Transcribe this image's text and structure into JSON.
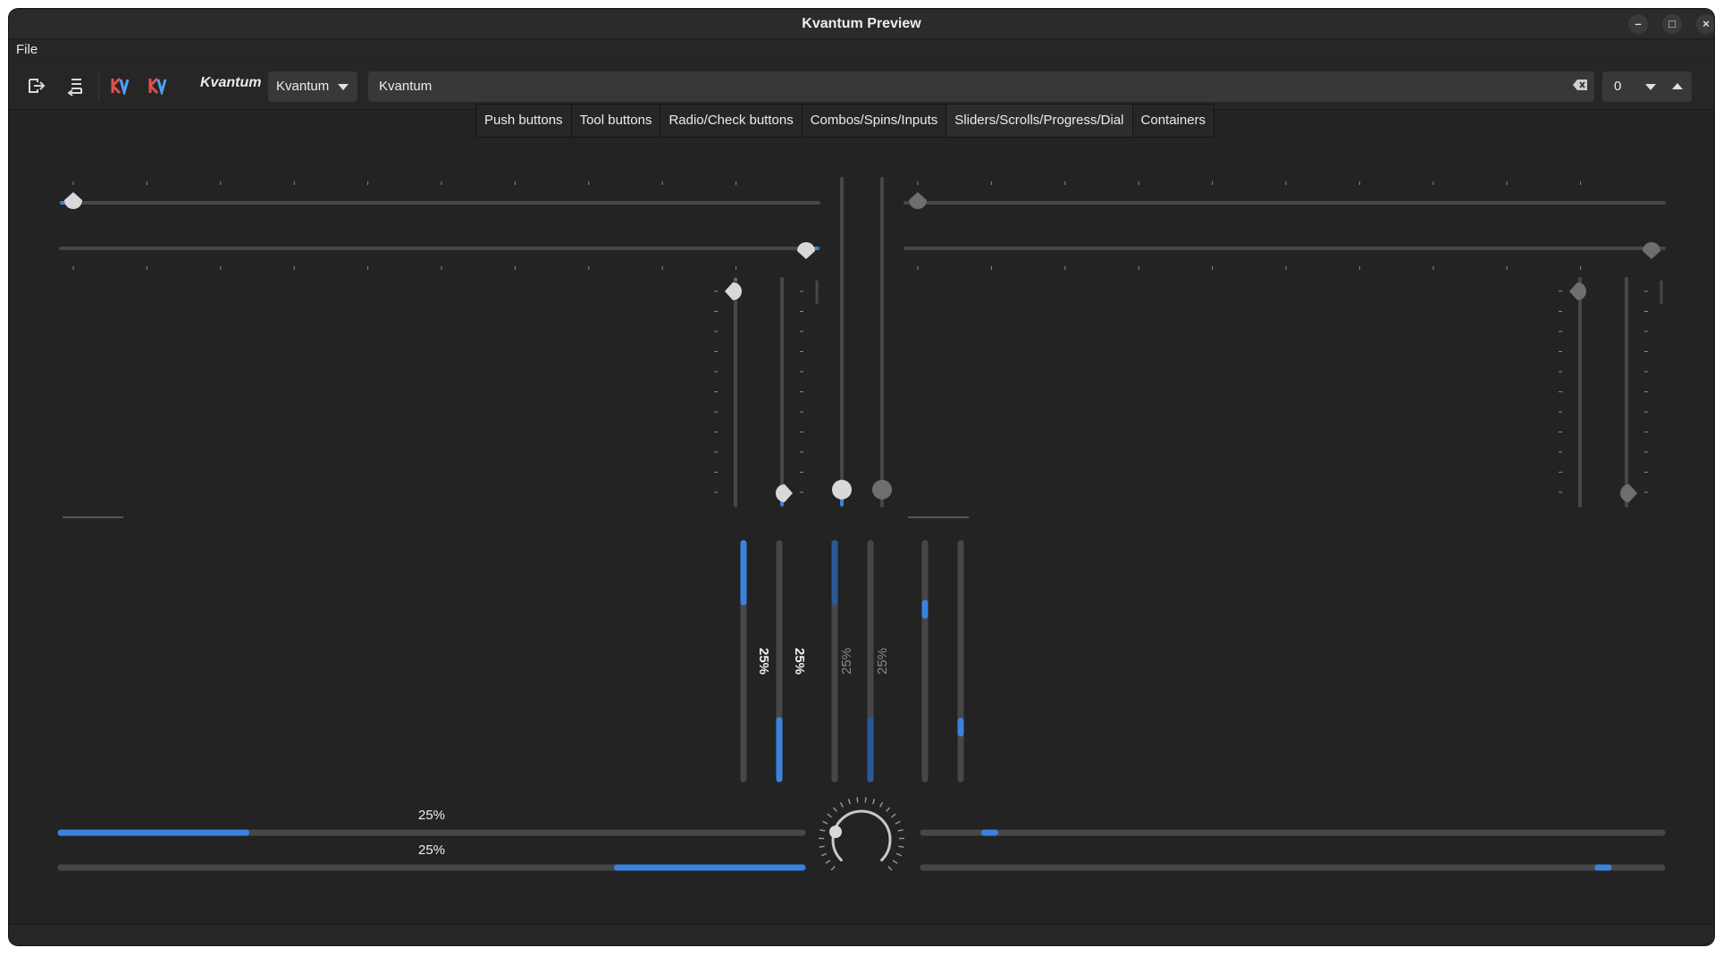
{
  "window": {
    "title": "Kvantum Preview",
    "controls": {
      "minimize": "–",
      "maximize": "□",
      "close": "×"
    }
  },
  "menubar": {
    "items": [
      "File"
    ]
  },
  "toolbar": {
    "icons": [
      "open-icon",
      "reload-icon",
      "kvantum-logo-icon",
      "kvantum-logo-icon"
    ],
    "label": "Kvantum",
    "combo_value": "Kvantum",
    "line_edit_value": "Kvantum",
    "spin_value": "0"
  },
  "tabs": [
    {
      "label": "Push buttons",
      "active": false
    },
    {
      "label": "Tool buttons",
      "active": false
    },
    {
      "label": "Radio/Check buttons",
      "active": false
    },
    {
      "label": "Combos/Spins/Inputs",
      "active": false
    },
    {
      "label": "Sliders/Scrolls/Progress/Dial",
      "active": true
    },
    {
      "label": "Containers",
      "active": false
    }
  ],
  "colors": {
    "accent": "#3b82e0",
    "accent_dim": "#2a5a96",
    "track": "#474747",
    "handle": "#d8d8d8",
    "handle_disabled": "#6e6e6e",
    "background": "#232323"
  },
  "sliders": {
    "horizontal_enabled": [
      {
        "value": 0,
        "ticks": "above"
      },
      {
        "value": 1,
        "ticks": "below"
      }
    ],
    "vertical_enabled": [
      {
        "value": 1,
        "ticks": "left"
      },
      {
        "value": 0,
        "ticks": "right"
      }
    ],
    "vertical_plain": [
      {
        "value": 0,
        "enabled": true
      },
      {
        "value": 0,
        "enabled": false
      }
    ],
    "horizontal_disabled": [
      {
        "value": 0,
        "ticks": "above"
      },
      {
        "value": 1,
        "ticks": "below"
      }
    ],
    "vertical_disabled": [
      {
        "value": 1,
        "ticks": "left"
      },
      {
        "value": 0,
        "ticks": "right"
      }
    ]
  },
  "progress": {
    "label": "25%",
    "value": 0.25,
    "horizontal": [
      {
        "value": 0.25,
        "inverted": false,
        "label": "25%"
      },
      {
        "value": 0.25,
        "inverted": true,
        "label": "25%"
      }
    ],
    "vertical": [
      {
        "value": 0.25,
        "inverted": false,
        "enabled": true,
        "label": "25%"
      },
      {
        "value": 0.25,
        "inverted": true,
        "enabled": true,
        "label": "25%"
      },
      {
        "value": 0.25,
        "inverted": false,
        "enabled": false,
        "label": "25%"
      },
      {
        "value": 0.25,
        "inverted": true,
        "enabled": false,
        "label": "25%"
      }
    ]
  },
  "scrollbars": {
    "vertical": [
      {
        "position": 0.28
      },
      {
        "position": 0.78
      }
    ],
    "horizontal": [
      {
        "position": 0.09
      },
      {
        "position": 0.92
      }
    ]
  },
  "dial": {
    "value": 0,
    "notches": 24
  }
}
